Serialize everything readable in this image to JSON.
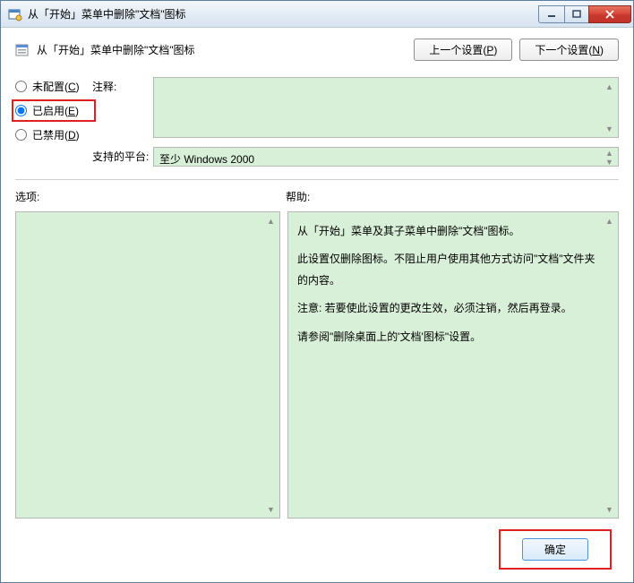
{
  "window": {
    "title": "从「开始」菜单中删除\"文档\"图标"
  },
  "header": {
    "policy_title": "从「开始」菜单中删除\"文档\"图标",
    "prev_btn": "上一个设置(",
    "prev_key": "P",
    "prev_btn_end": ")",
    "next_btn": "下一个设置(",
    "next_key": "N",
    "next_btn_end": ")"
  },
  "radios": {
    "not_configured": "未配置(",
    "not_configured_key": "C",
    "enabled": "已启用(",
    "enabled_key": "E",
    "disabled": "已禁用(",
    "disabled_key": "D",
    "close_paren": ")",
    "selected": "enabled"
  },
  "labels": {
    "comment": "注释:",
    "supported": "支持的平台:",
    "options": "选项:",
    "help": "帮助:"
  },
  "fields": {
    "comment_value": "",
    "supported_value": "至少 Windows 2000"
  },
  "help": {
    "p1": "从「开始」菜单及其子菜单中删除\"文档\"图标。",
    "p2": "此设置仅删除图标。不阻止用户使用其他方式访问\"文档\"文件夹的内容。",
    "p3": "注意: 若要使此设置的更改生效，必须注销，然后再登录。",
    "p4": "请参阅\"删除桌面上的'文档'图标\"设置。"
  },
  "footer": {
    "ok": "确定"
  }
}
